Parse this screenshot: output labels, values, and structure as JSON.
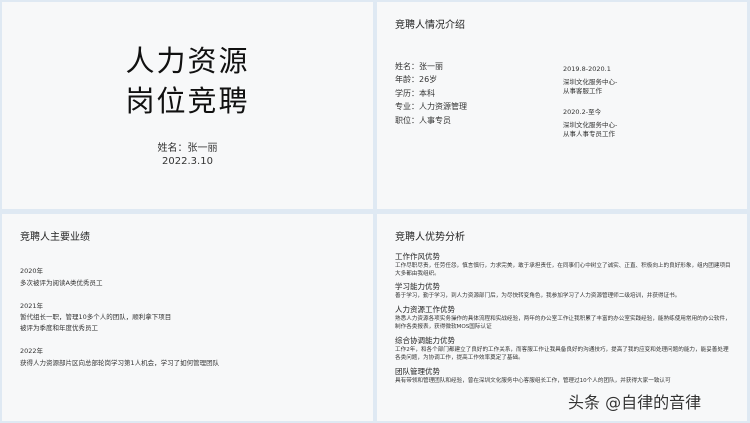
{
  "slide1": {
    "title_line1": "人力资源",
    "title_line2": "岗位竞聘",
    "name": "姓名：张一丽",
    "date": "2022.3.10"
  },
  "slide2": {
    "title": "竞聘人情况介绍",
    "info": [
      "姓名：张一丽",
      "年龄：26岁",
      "学历：本科",
      "专业：人力资源管理",
      "职位：人事专员"
    ],
    "experience": [
      {
        "period": "2019.8-2020.1",
        "line1": "深圳文化服务中心-",
        "line2": "从事客服工作"
      },
      {
        "period": "2020.2-至今",
        "line1": "深圳文化服务中心-",
        "line2": "从事人事专员工作"
      }
    ]
  },
  "slide3": {
    "title": "竞聘人主要业绩",
    "years": [
      {
        "year": "2020年",
        "lines": [
          "多次被评为阅读A类优秀员工"
        ]
      },
      {
        "year": "2021年",
        "lines": [
          "暂代组长一职，管理10多个人的团队，顺利拿下项目",
          "被评为季度和年度优秀员工"
        ]
      },
      {
        "year": "2022年",
        "lines": [
          "获得人力资源部片区向总部轮岗学习第1人机会，学习了如何管理团队"
        ]
      }
    ]
  },
  "slide4": {
    "title": "竞聘人优势分析",
    "sections": [
      {
        "heading": "工作作风优势",
        "text": "工作尽职尽责，任劳任怨，慎言慎行，力求完美，敢于承担责任，在同事们心中树立了诚实、正直、积极向上的良好形象，组内团建项目大多都由我组织。"
      },
      {
        "heading": "学习能力优势",
        "text": "善于学习，勤于学习，到人力资源部门后，为尽快转变角色，我参加学习了人力资源管理师二级培训，并获得证书。"
      },
      {
        "heading": "人力资源工作优势",
        "text": "熟悉人力资源各项实务操作的具体流程和实战经验，两年的办公室工作让我积累了丰富的办公室实践经验，能熟练使用常用的办公软件，制作各类报表，获得微软MOS国际认证"
      },
      {
        "heading": "综合协调能力优势",
        "text": "工作2年，和各个部门都建立了良好的工作关系，而客服工作让我具备良好的沟通技巧，提高了我的应变和处理问题的能力，能妥善处理各类问题，为协调工作，提高工作效率奠定了基础。"
      },
      {
        "heading": "团队管理优势",
        "text": "具有带领和管理团队和经验，曾在深圳文化服务中心客服组长工作，管理过10个人的团队，并获得大家一致认可"
      }
    ]
  },
  "watermark": "头条 @自律的音律"
}
